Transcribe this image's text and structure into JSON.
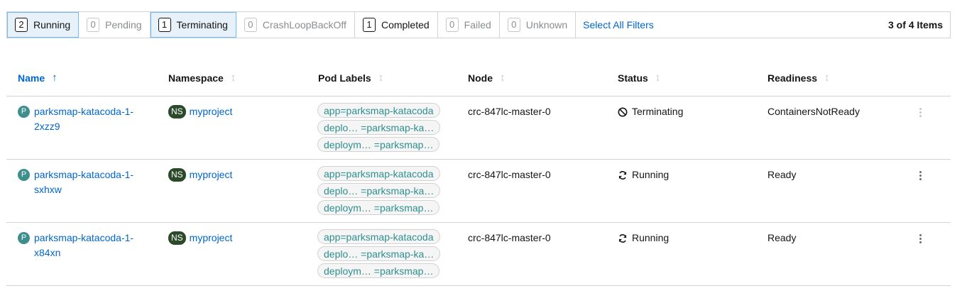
{
  "filters": [
    {
      "count": "2",
      "label": "Running",
      "active": true
    },
    {
      "count": "0",
      "label": "Pending",
      "active": false
    },
    {
      "count": "1",
      "label": "Terminating",
      "active": true
    },
    {
      "count": "0",
      "label": "CrashLoopBackOff",
      "active": false
    },
    {
      "count": "1",
      "label": "Completed",
      "active": false
    },
    {
      "count": "0",
      "label": "Failed",
      "active": false
    },
    {
      "count": "0",
      "label": "Unknown",
      "active": false
    }
  ],
  "select_all_label": "Select All Filters",
  "items_count": "3 of 4 Items",
  "columns": {
    "name": "Name",
    "namespace": "Namespace",
    "pod_labels": "Pod Labels",
    "node": "Node",
    "status": "Status",
    "readiness": "Readiness"
  },
  "rows": [
    {
      "badge": "P",
      "name_line1": "parksmap-katacoda-1-",
      "name_line2": "2xzz9",
      "ns_badge": "NS",
      "namespace": "myproject",
      "labels": [
        "app=parksmap-katacoda",
        "deplo… =parksmap-ka…",
        "deploym… =parksmap…"
      ],
      "node": "crc-847lc-master-0",
      "status": "Terminating",
      "status_icon": "ban-icon",
      "readiness": "ContainersNotReady"
    },
    {
      "badge": "P",
      "name_line1": "parksmap-katacoda-1-",
      "name_line2": "sxhxw",
      "ns_badge": "NS",
      "namespace": "myproject",
      "labels": [
        "app=parksmap-katacoda",
        "deplo… =parksmap-ka…",
        "deploym… =parksmap…"
      ],
      "node": "crc-847lc-master-0",
      "status": "Running",
      "status_icon": "sync-icon",
      "readiness": "Ready"
    },
    {
      "badge": "P",
      "name_line1": "parksmap-katacoda-1-",
      "name_line2": "x84xn",
      "ns_badge": "NS",
      "namespace": "myproject",
      "labels": [
        "app=parksmap-katacoda",
        "deplo… =parksmap-ka…",
        "deploym… =parksmap…"
      ],
      "node": "crc-847lc-master-0",
      "status": "Running",
      "status_icon": "sync-icon",
      "readiness": "Ready"
    }
  ],
  "colors": {
    "link": "#0066cc",
    "label_text": "#2e8f8f",
    "active_filter_bg": "#e7f1fa",
    "pod_badge": "#3e8e8e",
    "ns_badge": "#2b4a2a"
  }
}
